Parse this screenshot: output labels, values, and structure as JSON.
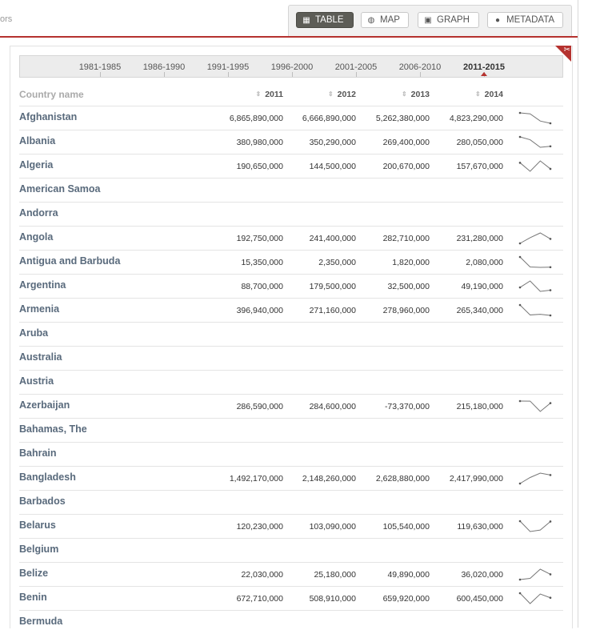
{
  "breadcrumb_fragment": "ors",
  "view_buttons": [
    {
      "label": "TABLE",
      "icon": "table-icon",
      "active": true
    },
    {
      "label": "MAP",
      "icon": "globe-icon",
      "active": false
    },
    {
      "label": "GRAPH",
      "icon": "image-icon",
      "active": false
    },
    {
      "label": "METADATA",
      "icon": "info-icon",
      "active": false
    }
  ],
  "year_ranges": [
    "1981-1985",
    "1986-1990",
    "1991-1995",
    "1996-2000",
    "2001-2005",
    "2006-2010",
    "2011-2015"
  ],
  "selected_range": "2011-2015",
  "table": {
    "name_header": "Country name",
    "year_headers": [
      "2011",
      "2012",
      "2013",
      "2014"
    ],
    "rows": [
      {
        "name": "Afghanistan",
        "values": [
          "6,865,890,000",
          "6,666,890,000",
          "5,262,380,000",
          "4,823,290,000"
        ]
      },
      {
        "name": "Albania",
        "values": [
          "380,980,000",
          "350,290,000",
          "269,400,000",
          "280,050,000"
        ]
      },
      {
        "name": "Algeria",
        "values": [
          "190,650,000",
          "144,500,000",
          "200,670,000",
          "157,670,000"
        ]
      },
      {
        "name": "American Samoa",
        "values": [
          "",
          "",
          "",
          ""
        ]
      },
      {
        "name": "Andorra",
        "values": [
          "",
          "",
          "",
          ""
        ]
      },
      {
        "name": "Angola",
        "values": [
          "192,750,000",
          "241,400,000",
          "282,710,000",
          "231,280,000"
        ]
      },
      {
        "name": "Antigua and Barbuda",
        "values": [
          "15,350,000",
          "2,350,000",
          "1,820,000",
          "2,080,000"
        ]
      },
      {
        "name": "Argentina",
        "values": [
          "88,700,000",
          "179,500,000",
          "32,500,000",
          "49,190,000"
        ]
      },
      {
        "name": "Armenia",
        "values": [
          "396,940,000",
          "271,160,000",
          "278,960,000",
          "265,340,000"
        ]
      },
      {
        "name": "Aruba",
        "values": [
          "",
          "",
          "",
          ""
        ]
      },
      {
        "name": "Australia",
        "values": [
          "",
          "",
          "",
          ""
        ]
      },
      {
        "name": "Austria",
        "values": [
          "",
          "",
          "",
          ""
        ]
      },
      {
        "name": "Azerbaijan",
        "values": [
          "286,590,000",
          "284,600,000",
          "-73,370,000",
          "215,180,000"
        ]
      },
      {
        "name": "Bahamas, The",
        "values": [
          "",
          "",
          "",
          ""
        ]
      },
      {
        "name": "Bahrain",
        "values": [
          "",
          "",
          "",
          ""
        ]
      },
      {
        "name": "Bangladesh",
        "values": [
          "1,492,170,000",
          "2,148,260,000",
          "2,628,880,000",
          "2,417,990,000"
        ]
      },
      {
        "name": "Barbados",
        "values": [
          "",
          "",
          "",
          ""
        ]
      },
      {
        "name": "Belarus",
        "values": [
          "120,230,000",
          "103,090,000",
          "105,540,000",
          "119,630,000"
        ]
      },
      {
        "name": "Belgium",
        "values": [
          "",
          "",
          "",
          ""
        ]
      },
      {
        "name": "Belize",
        "values": [
          "22,030,000",
          "25,180,000",
          "49,890,000",
          "36,020,000"
        ]
      },
      {
        "name": "Benin",
        "values": [
          "672,710,000",
          "508,910,000",
          "659,920,000",
          "600,450,000"
        ]
      },
      {
        "name": "Bermuda",
        "values": [
          "",
          "",
          "",
          ""
        ]
      }
    ]
  }
}
